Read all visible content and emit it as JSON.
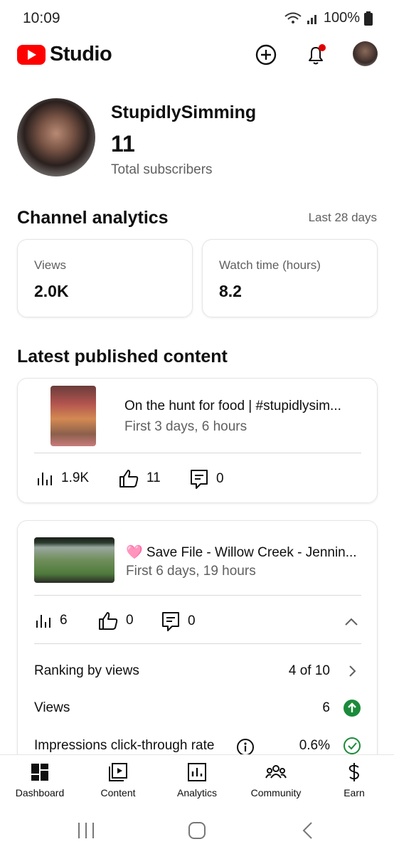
{
  "status": {
    "time": "10:09",
    "battery": "100%"
  },
  "header": {
    "logo_text": "Studio",
    "icons": [
      "create-icon",
      "bell-icon",
      "avatar"
    ]
  },
  "channel": {
    "name": "StupidlySimming",
    "subscribers": "11",
    "subscribers_label": "Total subscribers"
  },
  "analytics": {
    "title": "Channel analytics",
    "period": "Last 28 days",
    "views_label": "Views",
    "views_value": "2.0K",
    "watch_label": "Watch time (hours)",
    "watch_value": "8.2"
  },
  "latest": {
    "title": "Latest published content",
    "items": [
      {
        "title": "On the hunt for food | #stupidlysim...",
        "subtitle": "First 3 days, 6 hours",
        "views": "1.9K",
        "likes": "11",
        "comments": "0"
      },
      {
        "title": "🩷 Save File - Willow Creek - Jennin...",
        "subtitle": "First 6 days, 19 hours",
        "views": "6",
        "likes": "0",
        "comments": "0",
        "details": [
          {
            "label": "Ranking by views",
            "value": "4 of 10"
          },
          {
            "label": "Views",
            "value": "6"
          },
          {
            "label": "Impressions click-through rate",
            "value": "0.6%"
          }
        ]
      }
    ]
  },
  "nav": {
    "items": [
      "Dashboard",
      "Content",
      "Analytics",
      "Community",
      "Earn"
    ]
  },
  "colors": {
    "brand_red": "#ff0000",
    "notification_red": "#e00000",
    "positive_green": "#1b8a3a"
  }
}
